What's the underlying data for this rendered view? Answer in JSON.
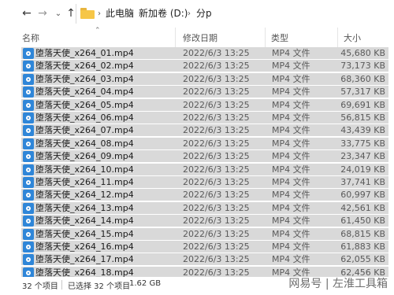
{
  "address_bar": {
    "nav_back_icon": "arrow-left-icon",
    "nav_forward_icon": "arrow-right-icon",
    "recent_icon": "chevron-down-icon",
    "up_icon": "arrow-up-icon",
    "folder_icon": "folder-icon",
    "breadcrumbs": [
      "此电脑",
      "新加卷 (D:)",
      "分p"
    ]
  },
  "columns": {
    "name": "名称",
    "modified": "修改日期",
    "type": "类型",
    "size": "大小"
  },
  "files": [
    {
      "name": "堕落天使_x264_01.mp4",
      "modified": "2022/6/3 13:25",
      "type": "MP4 文件",
      "size": "45,680 KB"
    },
    {
      "name": "堕落天使_x264_02.mp4",
      "modified": "2022/6/3 13:25",
      "type": "MP4 文件",
      "size": "73,173 KB"
    },
    {
      "name": "堕落天使_x264_03.mp4",
      "modified": "2022/6/3 13:25",
      "type": "MP4 文件",
      "size": "68,360 KB"
    },
    {
      "name": "堕落天使_x264_04.mp4",
      "modified": "2022/6/3 13:25",
      "type": "MP4 文件",
      "size": "57,317 KB"
    },
    {
      "name": "堕落天使_x264_05.mp4",
      "modified": "2022/6/3 13:25",
      "type": "MP4 文件",
      "size": "69,691 KB"
    },
    {
      "name": "堕落天使_x264_06.mp4",
      "modified": "2022/6/3 13:25",
      "type": "MP4 文件",
      "size": "56,815 KB"
    },
    {
      "name": "堕落天使_x264_07.mp4",
      "modified": "2022/6/3 13:25",
      "type": "MP4 文件",
      "size": "43,439 KB"
    },
    {
      "name": "堕落天使_x264_08.mp4",
      "modified": "2022/6/3 13:25",
      "type": "MP4 文件",
      "size": "33,775 KB"
    },
    {
      "name": "堕落天使_x264_09.mp4",
      "modified": "2022/6/3 13:25",
      "type": "MP4 文件",
      "size": "23,347 KB"
    },
    {
      "name": "堕落天使_x264_10.mp4",
      "modified": "2022/6/3 13:25",
      "type": "MP4 文件",
      "size": "24,019 KB"
    },
    {
      "name": "堕落天使_x264_11.mp4",
      "modified": "2022/6/3 13:25",
      "type": "MP4 文件",
      "size": "37,741 KB"
    },
    {
      "name": "堕落天使_x264_12.mp4",
      "modified": "2022/6/3 13:25",
      "type": "MP4 文件",
      "size": "60,997 KB"
    },
    {
      "name": "堕落天使_x264_13.mp4",
      "modified": "2022/6/3 13:25",
      "type": "MP4 文件",
      "size": "42,561 KB"
    },
    {
      "name": "堕落天使_x264_14.mp4",
      "modified": "2022/6/3 13:25",
      "type": "MP4 文件",
      "size": "61,450 KB"
    },
    {
      "name": "堕落天使_x264_15.mp4",
      "modified": "2022/6/3 13:25",
      "type": "MP4 文件",
      "size": "68,815 KB"
    },
    {
      "name": "堕落天使_x264_16.mp4",
      "modified": "2022/6/3 13:25",
      "type": "MP4 文件",
      "size": "61,883 KB"
    },
    {
      "name": "堕落天使_x264_17.mp4",
      "modified": "2022/6/3 13:25",
      "type": "MP4 文件",
      "size": "62,055 KB"
    },
    {
      "name": "堕落天使_x264_18.mp4",
      "modified": "2022/6/3 13:25",
      "type": "MP4 文件",
      "size": "62,456 KB"
    }
  ],
  "file_icon": "video-file-icon",
  "status_bar": {
    "item_count": "32 个项目",
    "selection": "已选择 32 个项目",
    "selection_size": "1.62 GB",
    "watermark": "网易号 | 左淮工具箱"
  }
}
